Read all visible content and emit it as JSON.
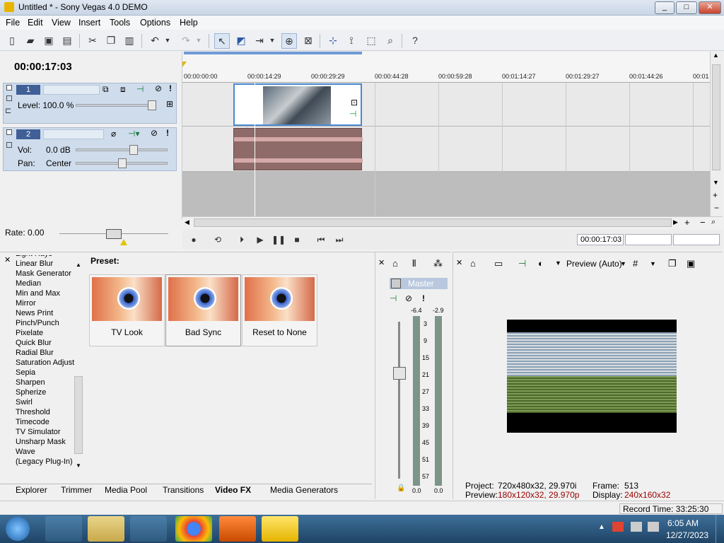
{
  "window": {
    "title": "Untitled * - Sony Vegas 4.0 DEMO",
    "controls": [
      "_",
      "□",
      "✕"
    ]
  },
  "menu": [
    "File",
    "Edit",
    "View",
    "Insert",
    "Tools",
    "Options",
    "Help"
  ],
  "timecode": "00:00:17:03",
  "tracks": [
    {
      "number": "1",
      "level_label": "Level: 100.0 %"
    },
    {
      "number": "2",
      "vol_label": "Vol:",
      "vol_value": "0.0 dB",
      "pan_label": "Pan:",
      "pan_value": "Center"
    }
  ],
  "ruler": [
    "00:00:00:00",
    "00:00:14:29",
    "00:00:29:29",
    "00:00:44:28",
    "00:00:59:28",
    "00:01:14:27",
    "00:01:29:27",
    "00:01:44:26",
    "00:01"
  ],
  "rate_label": "Rate: 0.00",
  "transport_timecode": "00:00:17:03",
  "fx": {
    "items": [
      "Light Rays",
      "Linear Blur",
      "Mask Generator",
      "Median",
      "Min and Max",
      "Mirror",
      "News Print",
      "Pinch/Punch",
      "Pixelate",
      "Quick Blur",
      "Radial Blur",
      "Saturation Adjust",
      "Sepia",
      "Sharpen",
      "Spherize",
      "Swirl",
      "Threshold",
      "Timecode",
      "TV Simulator",
      "Unsharp Mask",
      "Wave",
      "(Legacy Plug-In)"
    ],
    "preset_label": "Preset:",
    "presets": [
      "TV Look",
      "Bad Sync",
      "Reset to None"
    ]
  },
  "tabs": [
    "Explorer",
    "Trimmer",
    "Media Pool",
    "Transitions",
    "Video FX",
    "Media Generators"
  ],
  "mixer": {
    "title": "Master",
    "peak_left": "-6.4",
    "peak_right": "-2.9",
    "scale": [
      "3",
      "9",
      "15",
      "21",
      "27",
      "33",
      "39",
      "45",
      "51",
      "57"
    ],
    "bottom_left": "0.0",
    "bottom_right": "0.0"
  },
  "preview": {
    "mode": "Preview (Auto)",
    "project_label": "Project:",
    "project_value": "720x480x32, 29.970i",
    "preview_label": "Preview:",
    "preview_value": "180x120x32, 29.970p",
    "frame_label": "Frame:",
    "frame_value": "513",
    "display_label": "Display:",
    "display_value": "240x160x32",
    "value_color": "#990000"
  },
  "record_time": "Record Time: 33:25:30",
  "taskbar": {
    "time": "6:05 AM",
    "date": "12/27/2023"
  }
}
